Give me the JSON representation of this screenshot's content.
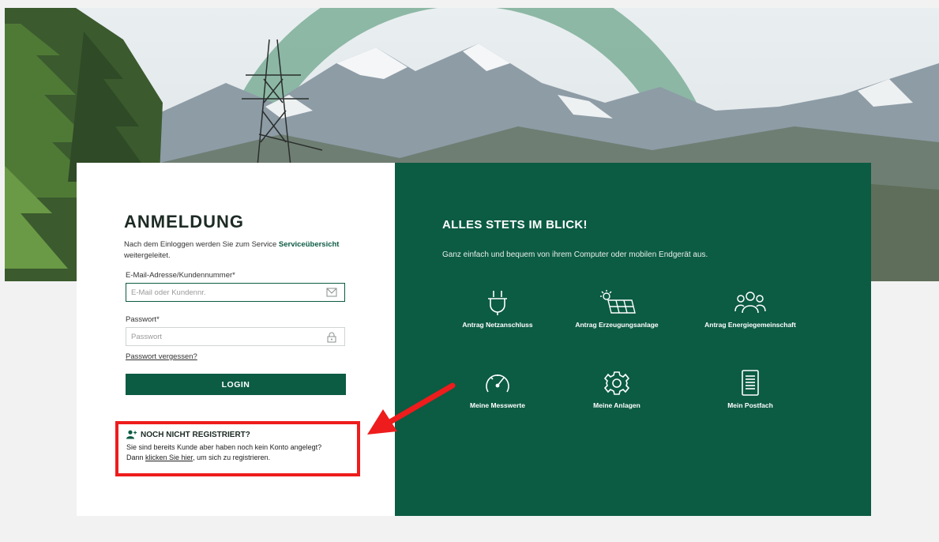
{
  "login": {
    "title": "ANMELDUNG",
    "intro_text": "Nach dem Einloggen werden Sie zum Service",
    "intro_link": "Serviceübersicht",
    "intro_suffix": "weitergeleitet.",
    "email_label": "E-Mail-Adresse/Kundennummer*",
    "email_placeholder": "E-Mail oder Kundennr.",
    "password_label": "Passwort*",
    "password_placeholder": "Passwort",
    "forgot_link": "Passwort vergessen?",
    "login_button": "LOGIN"
  },
  "register": {
    "title": "NOCH NICHT REGISTRIERT?",
    "line1": "Sie sind bereits Kunde aber haben noch kein Konto angelegt?",
    "line2_prefix": "Dann",
    "line2_link": "klicken Sie hier",
    "line2_suffix": ", um sich zu registrieren."
  },
  "promo": {
    "title": "ALLES STETS IM BLICK!",
    "subtitle": "Ganz einfach und bequem von ihrem Computer oder mobilen Endgerät aus.",
    "features": [
      {
        "label": "Antrag Netzanschluss",
        "icon": "plug-icon"
      },
      {
        "label": "Antrag Erzeugungsanlage",
        "icon": "solar-panel-icon"
      },
      {
        "label": "Antrag Energiegemeinschaft",
        "icon": "community-icon"
      },
      {
        "label": "Meine Messwerte",
        "icon": "gauge-icon"
      },
      {
        "label": "Meine Anlagen",
        "icon": "gear-icon"
      },
      {
        "label": "Mein Postfach",
        "icon": "document-icon"
      }
    ]
  },
  "colors": {
    "brand_green": "#0c5b43",
    "annotation_red": "#ee1c1c",
    "page_bg": "#f2f2f2"
  }
}
